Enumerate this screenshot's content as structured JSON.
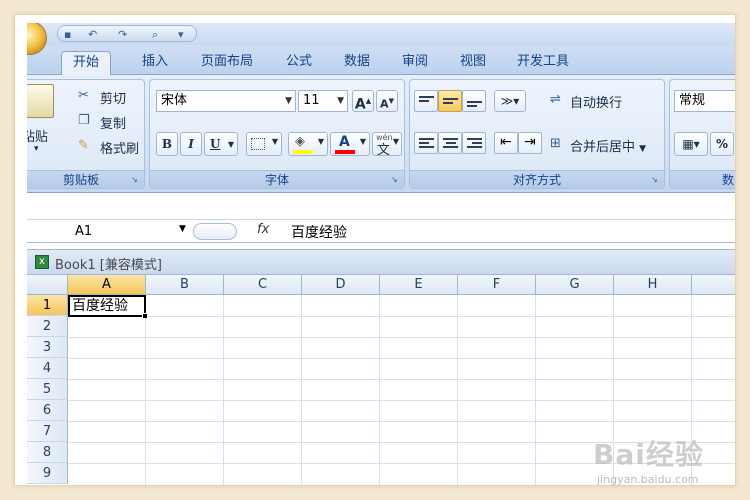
{
  "tabs": [
    "开始",
    "插入",
    "页面布局",
    "公式",
    "数据",
    "审阅",
    "视图",
    "开发工具"
  ],
  "clipboard": {
    "paste": "粘贴",
    "cut": "剪切",
    "copy": "复制",
    "format_painter": "格式刷",
    "label": "剪贴板"
  },
  "font": {
    "name": "宋体",
    "size": "11",
    "grow": "A",
    "shrink": "A",
    "bold": "B",
    "italic": "I",
    "underline": "U",
    "label": "字体",
    "font_color": "A",
    "phonetic": "文"
  },
  "alignment": {
    "wrap_text": "自动换行",
    "merge_center": "合并后居中",
    "label": "对齐方式"
  },
  "number": {
    "format": "常规",
    "percent": "%",
    "label": "数字"
  },
  "formula_bar": {
    "name_box": "A1",
    "fx": "fx",
    "value": "百度经验"
  },
  "workbook": {
    "title": "Book1 [兼容模式]"
  },
  "grid": {
    "columns": [
      "A",
      "B",
      "C",
      "D",
      "E",
      "F",
      "G",
      "H"
    ],
    "rows": [
      "1",
      "2",
      "3",
      "4",
      "5",
      "6",
      "7",
      "8",
      "9"
    ],
    "cell_a1": "百度经验"
  },
  "watermark": {
    "main": "Bai经验",
    "sub": "jingyan.baidu.com"
  },
  "colors": {
    "accent": "#15428b",
    "selection": "#f5c65d",
    "fill_color_bar": "#ffff00",
    "font_color_bar": "#ff0000"
  }
}
